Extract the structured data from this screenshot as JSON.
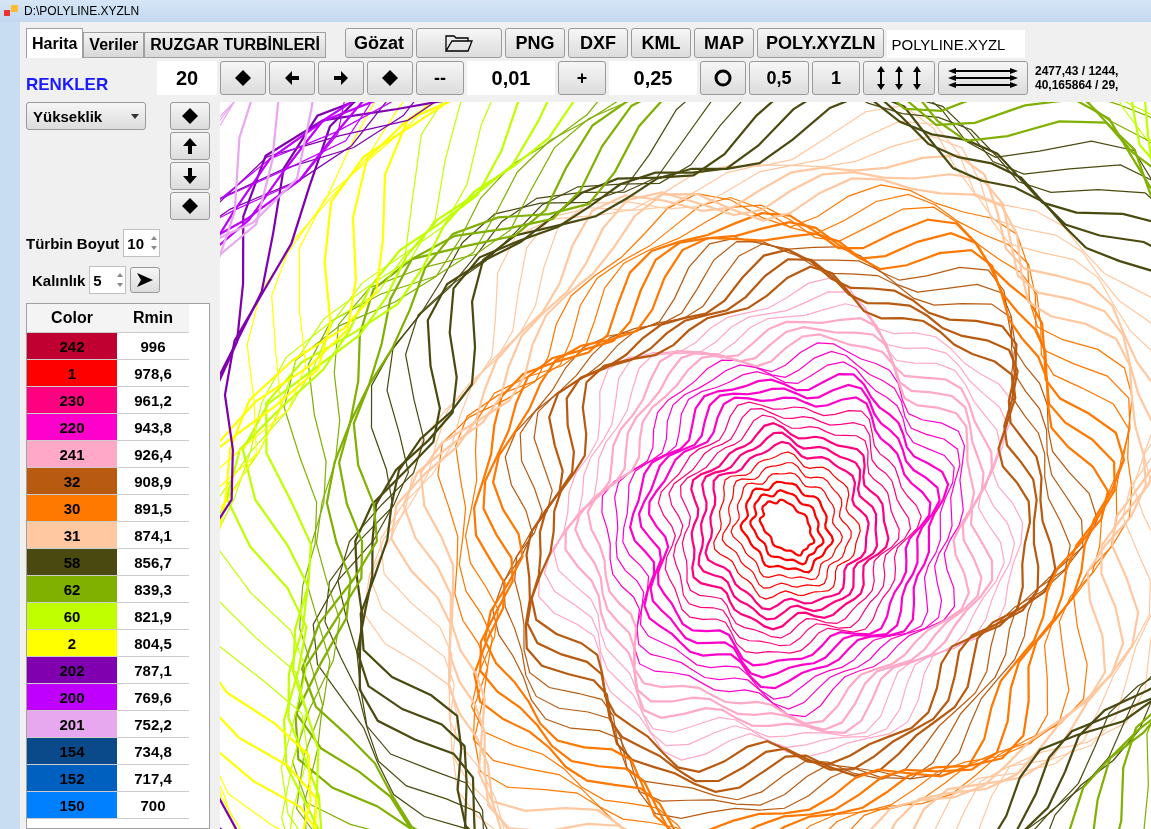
{
  "window": {
    "title": "D:\\POLYLINE.XYZLN"
  },
  "tabs": [
    {
      "label": "Harita",
      "selected": true
    },
    {
      "label": "Veriler",
      "selected": false
    },
    {
      "label": "RUZGAR TURBİNLERİ",
      "selected": false
    }
  ],
  "top_buttons": [
    {
      "kind": "text",
      "label": "Gözat"
    },
    {
      "kind": "folder"
    },
    {
      "kind": "text",
      "label": "PNG"
    },
    {
      "kind": "text",
      "label": "DXF"
    },
    {
      "kind": "text",
      "label": "KML"
    },
    {
      "kind": "text",
      "label": "MAP"
    },
    {
      "kind": "text",
      "label": "POLY.XYZLN"
    }
  ],
  "file_field": {
    "value": "POLYLINE.XYZL"
  },
  "renkler_label": "RENKLER",
  "toolbar": [
    {
      "kind": "field",
      "value": "20"
    },
    {
      "kind": "diamond"
    },
    {
      "kind": "left"
    },
    {
      "kind": "right"
    },
    {
      "kind": "diamond"
    },
    {
      "kind": "text",
      "label": "--"
    },
    {
      "kind": "field",
      "value": "0,01"
    },
    {
      "kind": "text",
      "label": "+"
    },
    {
      "kind": "field",
      "value": "0,25"
    },
    {
      "kind": "circle"
    },
    {
      "kind": "text",
      "label": "0,5"
    },
    {
      "kind": "text",
      "label": "1"
    },
    {
      "kind": "vertical"
    },
    {
      "kind": "horizontal"
    }
  ],
  "coordinates": [
    "2477,43 / 1244,",
    "40,165864 / 29,"
  ],
  "mode_dropdown": {
    "value": "Yükseklik"
  },
  "side_buttons": [
    {
      "kind": "diamond"
    },
    {
      "kind": "up"
    },
    {
      "kind": "down"
    },
    {
      "kind": "diamond"
    }
  ],
  "turbine_size": {
    "label": "Türbin Boyut",
    "value": "10"
  },
  "thickness": {
    "label": "Kalınlık",
    "value": "5"
  },
  "table": {
    "columns": [
      "Color",
      "Rmin"
    ],
    "rows": [
      {
        "code": "242",
        "rmin": "996",
        "color": "#c00030"
      },
      {
        "code": "1",
        "rmin": "978,6",
        "color": "#ff0000"
      },
      {
        "code": "230",
        "rmin": "961,2",
        "color": "#ff0080"
      },
      {
        "code": "220",
        "rmin": "943,8",
        "color": "#ff00cc"
      },
      {
        "code": "241",
        "rmin": "926,4",
        "color": "#ffa8c8"
      },
      {
        "code": "32",
        "rmin": "908,9",
        "color": "#b85a10"
      },
      {
        "code": "30",
        "rmin": "891,5",
        "color": "#ff7800"
      },
      {
        "code": "31",
        "rmin": "874,1",
        "color": "#ffc8a0"
      },
      {
        "code": "58",
        "rmin": "856,7",
        "color": "#4a4a10"
      },
      {
        "code": "62",
        "rmin": "839,3",
        "color": "#80b000"
      },
      {
        "code": "60",
        "rmin": "821,9",
        "color": "#c0ff00"
      },
      {
        "code": "2",
        "rmin": "804,5",
        "color": "#ffff00"
      },
      {
        "code": "202",
        "rmin": "787,1",
        "color": "#8000b0"
      },
      {
        "code": "200",
        "rmin": "769,6",
        "color": "#c000ff"
      },
      {
        "code": "201",
        "rmin": "752,2",
        "color": "#e8a8f0"
      },
      {
        "code": "154",
        "rmin": "734,8",
        "color": "#0a4a8a"
      },
      {
        "code": "152",
        "rmin": "717,4",
        "color": "#0060c0"
      },
      {
        "code": "150",
        "rmin": "700",
        "color": "#0080ff"
      }
    ]
  }
}
